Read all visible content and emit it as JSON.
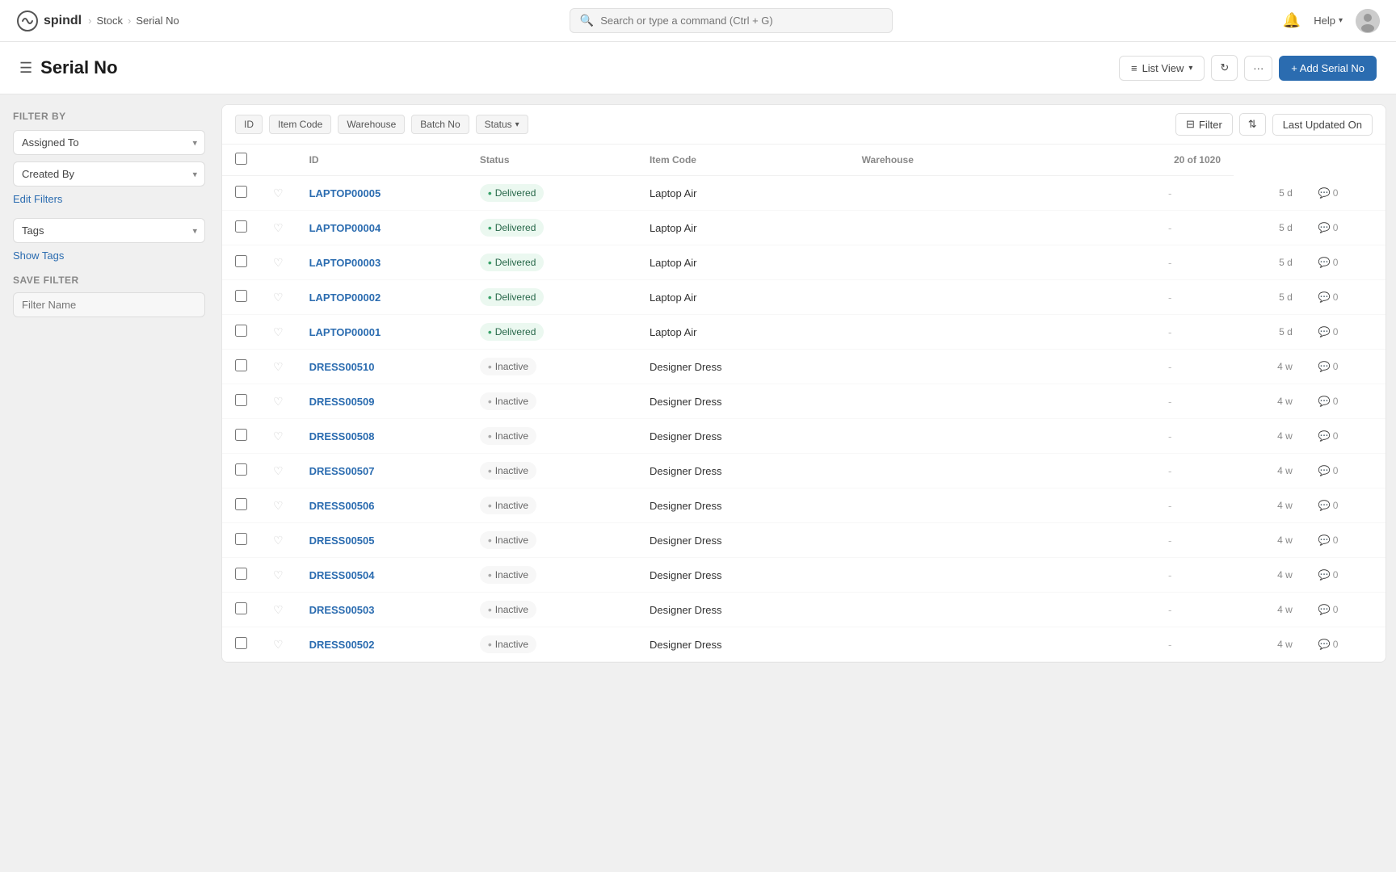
{
  "app": {
    "logo_text": "spindl",
    "breadcrumb": [
      "Stock",
      "Serial No"
    ]
  },
  "topnav": {
    "search_placeholder": "Search or type a command (Ctrl + G)",
    "help_label": "Help"
  },
  "page": {
    "title": "Serial No",
    "view_label": "List View",
    "add_button": "+ Add Serial No",
    "more_label": "···"
  },
  "sidebar": {
    "filter_by_label": "Filter By",
    "assigned_to_label": "Assigned To",
    "created_by_label": "Created By",
    "edit_filters_link": "Edit Filters",
    "tags_label": "Tags",
    "show_tags_link": "Show Tags",
    "save_filter_label": "Save Filter",
    "filter_name_placeholder": "Filter Name"
  },
  "table": {
    "filter_tags": [
      "ID",
      "Item Code",
      "Warehouse",
      "Batch No",
      "Status"
    ],
    "filter_btn": "Filter",
    "last_updated_btn": "Last Updated On",
    "columns": {
      "id": "ID",
      "status": "Status",
      "item_code": "Item Code",
      "warehouse": "Warehouse",
      "count": "20 of 1020"
    },
    "rows": [
      {
        "id": "LAPTOP00005",
        "status": "Delivered",
        "status_type": "delivered",
        "item_code": "Laptop Air",
        "warehouse": "",
        "time": "5 d",
        "comments": "0"
      },
      {
        "id": "LAPTOP00004",
        "status": "Delivered",
        "status_type": "delivered",
        "item_code": "Laptop Air",
        "warehouse": "",
        "time": "5 d",
        "comments": "0"
      },
      {
        "id": "LAPTOP00003",
        "status": "Delivered",
        "status_type": "delivered",
        "item_code": "Laptop Air",
        "warehouse": "",
        "time": "5 d",
        "comments": "0"
      },
      {
        "id": "LAPTOP00002",
        "status": "Delivered",
        "status_type": "delivered",
        "item_code": "Laptop Air",
        "warehouse": "",
        "time": "5 d",
        "comments": "0"
      },
      {
        "id": "LAPTOP00001",
        "status": "Delivered",
        "status_type": "delivered",
        "item_code": "Laptop Air",
        "warehouse": "",
        "time": "5 d",
        "comments": "0"
      },
      {
        "id": "DRESS00510",
        "status": "Inactive",
        "status_type": "inactive",
        "item_code": "Designer Dress",
        "warehouse": "",
        "time": "4 w",
        "comments": "0"
      },
      {
        "id": "DRESS00509",
        "status": "Inactive",
        "status_type": "inactive",
        "item_code": "Designer Dress",
        "warehouse": "",
        "time": "4 w",
        "comments": "0"
      },
      {
        "id": "DRESS00508",
        "status": "Inactive",
        "status_type": "inactive",
        "item_code": "Designer Dress",
        "warehouse": "",
        "time": "4 w",
        "comments": "0"
      },
      {
        "id": "DRESS00507",
        "status": "Inactive",
        "status_type": "inactive",
        "item_code": "Designer Dress",
        "warehouse": "",
        "time": "4 w",
        "comments": "0"
      },
      {
        "id": "DRESS00506",
        "status": "Inactive",
        "status_type": "inactive",
        "item_code": "Designer Dress",
        "warehouse": "",
        "time": "4 w",
        "comments": "0"
      },
      {
        "id": "DRESS00505",
        "status": "Inactive",
        "status_type": "inactive",
        "item_code": "Designer Dress",
        "warehouse": "",
        "time": "4 w",
        "comments": "0"
      },
      {
        "id": "DRESS00504",
        "status": "Inactive",
        "status_type": "inactive",
        "item_code": "Designer Dress",
        "warehouse": "",
        "time": "4 w",
        "comments": "0"
      },
      {
        "id": "DRESS00503",
        "status": "Inactive",
        "status_type": "inactive",
        "item_code": "Designer Dress",
        "warehouse": "",
        "time": "4 w",
        "comments": "0"
      },
      {
        "id": "DRESS00502",
        "status": "Inactive",
        "status_type": "inactive",
        "item_code": "Designer Dress",
        "warehouse": "",
        "time": "4 w",
        "comments": "0"
      }
    ]
  }
}
